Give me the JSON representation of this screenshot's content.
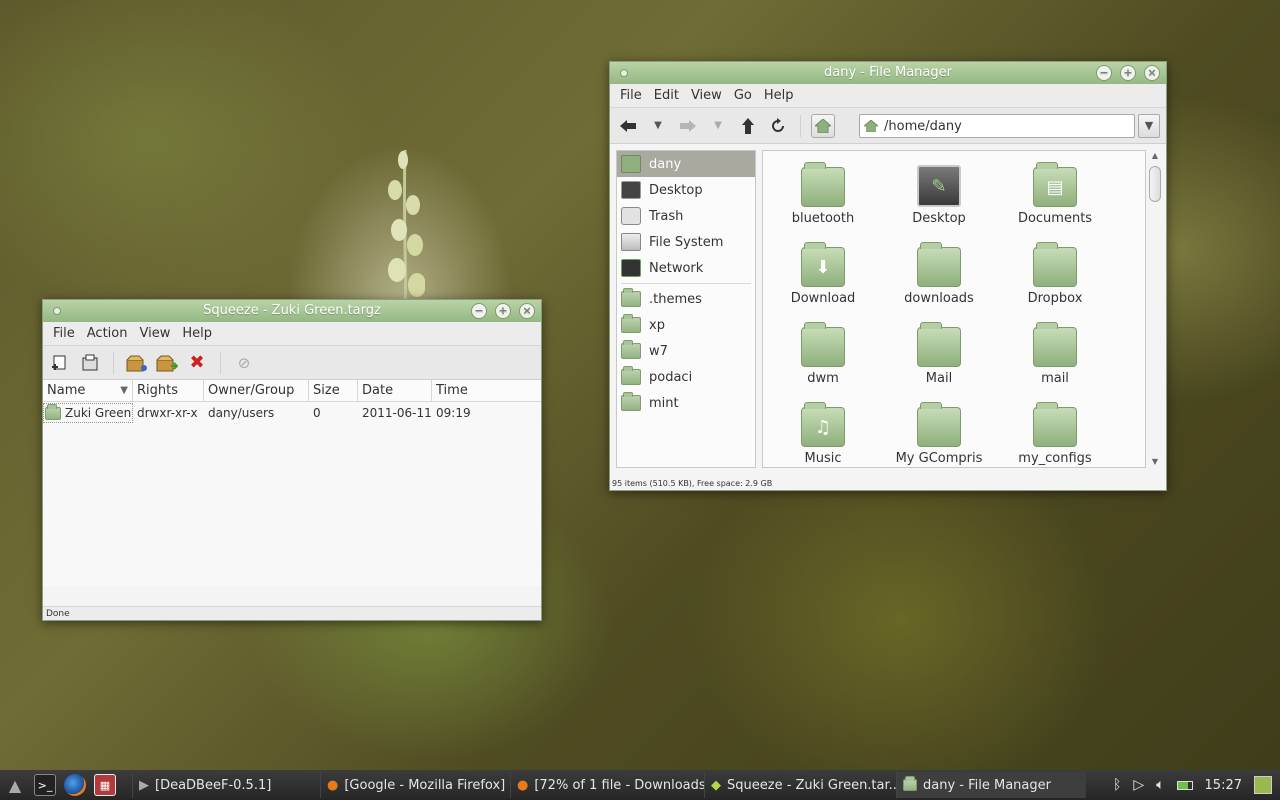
{
  "colors": {
    "accent": "#94b883",
    "titlebar_top": "#b9d3a6",
    "taskbar": "#2e2e2e",
    "close_red": "#cc2222"
  },
  "file_manager": {
    "title": "dany - File Manager",
    "menu": [
      "File",
      "Edit",
      "View",
      "Go",
      "Help"
    ],
    "toolbar": {
      "back_icon": "arrow-left-icon",
      "forward_icon": "arrow-right-icon",
      "up_icon": "arrow-up-icon",
      "reload_icon": "reload-icon",
      "home_icon": "home-icon"
    },
    "location": "/home/dany",
    "sidebar": [
      {
        "label": "dany",
        "icon": "home-icon",
        "selected": true
      },
      {
        "label": "Desktop",
        "icon": "desktop-icon"
      },
      {
        "label": "Trash",
        "icon": "trash-icon"
      },
      {
        "label": "File System",
        "icon": "drive-icon"
      },
      {
        "label": "Network",
        "icon": "network-icon"
      },
      {
        "label": ".themes",
        "icon": "folder-icon"
      },
      {
        "label": "xp",
        "icon": "folder-icon"
      },
      {
        "label": "w7",
        "icon": "folder-icon"
      },
      {
        "label": "podaci",
        "icon": "folder-icon"
      },
      {
        "label": "mint",
        "icon": "folder-icon"
      }
    ],
    "items": [
      {
        "label": "bluetooth",
        "icon": "folder-icon"
      },
      {
        "label": "Desktop",
        "icon": "desktop-icon"
      },
      {
        "label": "Documents",
        "icon": "documents-folder-icon"
      },
      {
        "label": "Download",
        "icon": "download-folder-icon"
      },
      {
        "label": "downloads",
        "icon": "folder-icon"
      },
      {
        "label": "Dropbox",
        "icon": "folder-icon"
      },
      {
        "label": "dwm",
        "icon": "folder-icon"
      },
      {
        "label": "Mail",
        "icon": "folder-icon"
      },
      {
        "label": "mail",
        "icon": "folder-icon"
      },
      {
        "label": "Music",
        "icon": "music-folder-icon"
      },
      {
        "label": "My GCompris",
        "icon": "folder-icon"
      },
      {
        "label": "my_configs",
        "icon": "folder-icon"
      }
    ],
    "status": "95 items (510.5 KB), Free space: 2.9 GB"
  },
  "squeeze": {
    "title": "Squeeze - Zuki Green.targz",
    "menu": [
      "File",
      "Action",
      "View",
      "Help"
    ],
    "columns": [
      "Name",
      "Rights",
      "Owner/Group",
      "Size",
      "Date",
      "Time"
    ],
    "rows": [
      {
        "name": "Zuki Green",
        "rights": "drwxr-xr-x",
        "owner": "dany/users",
        "size": "0",
        "date": "2011-06-11",
        "time": "09:19"
      }
    ],
    "status": "Done"
  },
  "taskbar": {
    "tasks": [
      {
        "label": "[DeaDBeeF-0.5.1]",
        "icon": "media-player-icon"
      },
      {
        "label": "[Google - Mozilla Firefox]",
        "icon": "firefox-icon"
      },
      {
        "label": "[72% of 1 file - Downloads]",
        "icon": "firefox-icon"
      },
      {
        "label": "Squeeze - Zuki Green.tar...",
        "icon": "squeeze-icon"
      },
      {
        "label": "dany - File Manager",
        "icon": "folder-icon"
      }
    ],
    "clock": "15:27"
  }
}
